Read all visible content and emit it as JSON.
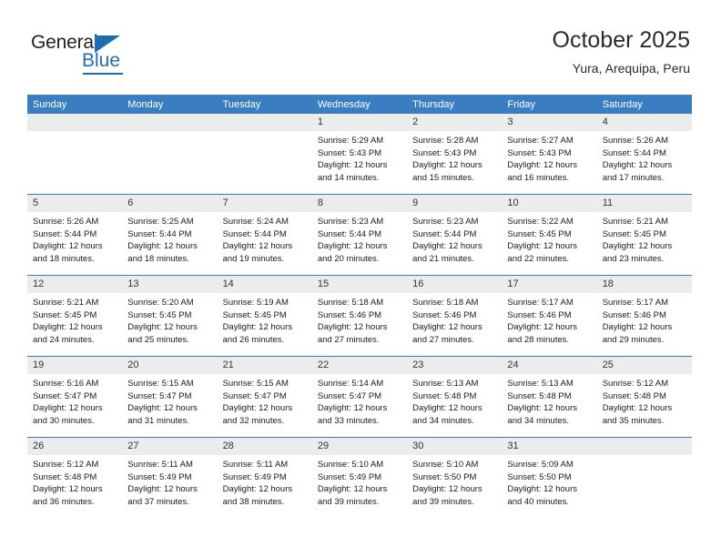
{
  "brand": {
    "name_part1": "General",
    "name_part2": "Blue",
    "triangle_icon": "triangle-icon",
    "accent_color": "#1f6cb0"
  },
  "header": {
    "title": "October 2025",
    "subtitle": "Yura, Arequipa, Peru"
  },
  "calendar": {
    "header_bg": "#3a7dc0",
    "daynum_bg": "#ececec",
    "weekday_headers": [
      "Sunday",
      "Monday",
      "Tuesday",
      "Wednesday",
      "Thursday",
      "Friday",
      "Saturday"
    ],
    "weeks": [
      [
        {
          "day": "",
          "blank": true,
          "sunrise": "",
          "sunset": "",
          "daylight": ""
        },
        {
          "day": "",
          "blank": true,
          "sunrise": "",
          "sunset": "",
          "daylight": ""
        },
        {
          "day": "",
          "blank": true,
          "sunrise": "",
          "sunset": "",
          "daylight": ""
        },
        {
          "day": "1",
          "blank": false,
          "sunrise": "Sunrise: 5:29 AM",
          "sunset": "Sunset: 5:43 PM",
          "daylight": "Daylight: 12 hours and 14 minutes."
        },
        {
          "day": "2",
          "blank": false,
          "sunrise": "Sunrise: 5:28 AM",
          "sunset": "Sunset: 5:43 PM",
          "daylight": "Daylight: 12 hours and 15 minutes."
        },
        {
          "day": "3",
          "blank": false,
          "sunrise": "Sunrise: 5:27 AM",
          "sunset": "Sunset: 5:43 PM",
          "daylight": "Daylight: 12 hours and 16 minutes."
        },
        {
          "day": "4",
          "blank": false,
          "sunrise": "Sunrise: 5:26 AM",
          "sunset": "Sunset: 5:44 PM",
          "daylight": "Daylight: 12 hours and 17 minutes."
        }
      ],
      [
        {
          "day": "5",
          "blank": false,
          "sunrise": "Sunrise: 5:26 AM",
          "sunset": "Sunset: 5:44 PM",
          "daylight": "Daylight: 12 hours and 18 minutes."
        },
        {
          "day": "6",
          "blank": false,
          "sunrise": "Sunrise: 5:25 AM",
          "sunset": "Sunset: 5:44 PM",
          "daylight": "Daylight: 12 hours and 18 minutes."
        },
        {
          "day": "7",
          "blank": false,
          "sunrise": "Sunrise: 5:24 AM",
          "sunset": "Sunset: 5:44 PM",
          "daylight": "Daylight: 12 hours and 19 minutes."
        },
        {
          "day": "8",
          "blank": false,
          "sunrise": "Sunrise: 5:23 AM",
          "sunset": "Sunset: 5:44 PM",
          "daylight": "Daylight: 12 hours and 20 minutes."
        },
        {
          "day": "9",
          "blank": false,
          "sunrise": "Sunrise: 5:23 AM",
          "sunset": "Sunset: 5:44 PM",
          "daylight": "Daylight: 12 hours and 21 minutes."
        },
        {
          "day": "10",
          "blank": false,
          "sunrise": "Sunrise: 5:22 AM",
          "sunset": "Sunset: 5:45 PM",
          "daylight": "Daylight: 12 hours and 22 minutes."
        },
        {
          "day": "11",
          "blank": false,
          "sunrise": "Sunrise: 5:21 AM",
          "sunset": "Sunset: 5:45 PM",
          "daylight": "Daylight: 12 hours and 23 minutes."
        }
      ],
      [
        {
          "day": "12",
          "blank": false,
          "sunrise": "Sunrise: 5:21 AM",
          "sunset": "Sunset: 5:45 PM",
          "daylight": "Daylight: 12 hours and 24 minutes."
        },
        {
          "day": "13",
          "blank": false,
          "sunrise": "Sunrise: 5:20 AM",
          "sunset": "Sunset: 5:45 PM",
          "daylight": "Daylight: 12 hours and 25 minutes."
        },
        {
          "day": "14",
          "blank": false,
          "sunrise": "Sunrise: 5:19 AM",
          "sunset": "Sunset: 5:45 PM",
          "daylight": "Daylight: 12 hours and 26 minutes."
        },
        {
          "day": "15",
          "blank": false,
          "sunrise": "Sunrise: 5:18 AM",
          "sunset": "Sunset: 5:46 PM",
          "daylight": "Daylight: 12 hours and 27 minutes."
        },
        {
          "day": "16",
          "blank": false,
          "sunrise": "Sunrise: 5:18 AM",
          "sunset": "Sunset: 5:46 PM",
          "daylight": "Daylight: 12 hours and 27 minutes."
        },
        {
          "day": "17",
          "blank": false,
          "sunrise": "Sunrise: 5:17 AM",
          "sunset": "Sunset: 5:46 PM",
          "daylight": "Daylight: 12 hours and 28 minutes."
        },
        {
          "day": "18",
          "blank": false,
          "sunrise": "Sunrise: 5:17 AM",
          "sunset": "Sunset: 5:46 PM",
          "daylight": "Daylight: 12 hours and 29 minutes."
        }
      ],
      [
        {
          "day": "19",
          "blank": false,
          "sunrise": "Sunrise: 5:16 AM",
          "sunset": "Sunset: 5:47 PM",
          "daylight": "Daylight: 12 hours and 30 minutes."
        },
        {
          "day": "20",
          "blank": false,
          "sunrise": "Sunrise: 5:15 AM",
          "sunset": "Sunset: 5:47 PM",
          "daylight": "Daylight: 12 hours and 31 minutes."
        },
        {
          "day": "21",
          "blank": false,
          "sunrise": "Sunrise: 5:15 AM",
          "sunset": "Sunset: 5:47 PM",
          "daylight": "Daylight: 12 hours and 32 minutes."
        },
        {
          "day": "22",
          "blank": false,
          "sunrise": "Sunrise: 5:14 AM",
          "sunset": "Sunset: 5:47 PM",
          "daylight": "Daylight: 12 hours and 33 minutes."
        },
        {
          "day": "23",
          "blank": false,
          "sunrise": "Sunrise: 5:13 AM",
          "sunset": "Sunset: 5:48 PM",
          "daylight": "Daylight: 12 hours and 34 minutes."
        },
        {
          "day": "24",
          "blank": false,
          "sunrise": "Sunrise: 5:13 AM",
          "sunset": "Sunset: 5:48 PM",
          "daylight": "Daylight: 12 hours and 34 minutes."
        },
        {
          "day": "25",
          "blank": false,
          "sunrise": "Sunrise: 5:12 AM",
          "sunset": "Sunset: 5:48 PM",
          "daylight": "Daylight: 12 hours and 35 minutes."
        }
      ],
      [
        {
          "day": "26",
          "blank": false,
          "sunrise": "Sunrise: 5:12 AM",
          "sunset": "Sunset: 5:48 PM",
          "daylight": "Daylight: 12 hours and 36 minutes."
        },
        {
          "day": "27",
          "blank": false,
          "sunrise": "Sunrise: 5:11 AM",
          "sunset": "Sunset: 5:49 PM",
          "daylight": "Daylight: 12 hours and 37 minutes."
        },
        {
          "day": "28",
          "blank": false,
          "sunrise": "Sunrise: 5:11 AM",
          "sunset": "Sunset: 5:49 PM",
          "daylight": "Daylight: 12 hours and 38 minutes."
        },
        {
          "day": "29",
          "blank": false,
          "sunrise": "Sunrise: 5:10 AM",
          "sunset": "Sunset: 5:49 PM",
          "daylight": "Daylight: 12 hours and 39 minutes."
        },
        {
          "day": "30",
          "blank": false,
          "sunrise": "Sunrise: 5:10 AM",
          "sunset": "Sunset: 5:50 PM",
          "daylight": "Daylight: 12 hours and 39 minutes."
        },
        {
          "day": "31",
          "blank": false,
          "sunrise": "Sunrise: 5:09 AM",
          "sunset": "Sunset: 5:50 PM",
          "daylight": "Daylight: 12 hours and 40 minutes."
        },
        {
          "day": "",
          "blank": true,
          "sunrise": "",
          "sunset": "",
          "daylight": ""
        }
      ]
    ]
  }
}
